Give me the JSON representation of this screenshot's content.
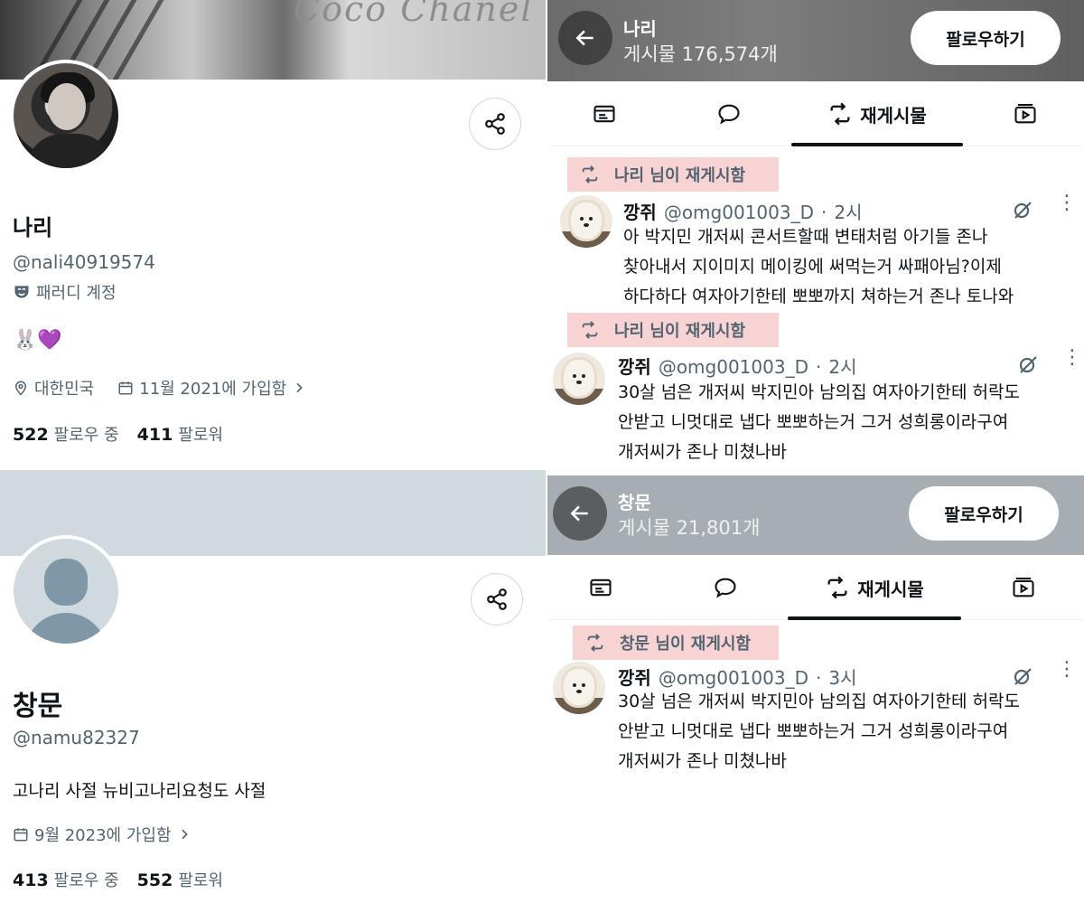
{
  "profile1": {
    "banner_text": "Coco Chanel",
    "display_name": "나리",
    "handle": "@nali40919574",
    "parody_label": "패러디 계정",
    "bio": "🐰💜",
    "location": "대한민국",
    "joined": "11월 2021에 가입함",
    "following_count": "522",
    "following_label": "팔로우 중",
    "followers_count": "411",
    "followers_label": "팔로워"
  },
  "profile2": {
    "display_name": "창문",
    "handle": "@namu82327",
    "bio": "고나리 사절 뉴비고나리요청도 사절",
    "joined": "9월 2023에 가입함",
    "following_count": "413",
    "following_label": "팔로우 중",
    "followers_count": "552",
    "followers_label": "팔로워"
  },
  "timeline1": {
    "header_name": "나리",
    "header_posts": "게시물 176,574개",
    "follow_label": "팔로우하기",
    "reposts_tab": "재게시물",
    "tweets": [
      {
        "repost_label": "나리 님이 재게시함",
        "author": "깡쥐",
        "handle": "@omg001003_D",
        "dot": "·",
        "time": "2시",
        "lines": [
          "아 박지민 개저씨 콘서트할때 변태처럼 아기들 존나",
          "찾아내서 지이미지 메이킹에 써먹는거 싸패아님?이제",
          "하다하다 여자아기한테 뽀뽀까지 쳐하는거 존나 토나와"
        ]
      },
      {
        "repost_label": "나리 님이 재게시함",
        "author": "깡쥐",
        "handle": "@omg001003_D",
        "dot": "·",
        "time": "2시",
        "lines": [
          "30살 넘은 개저씨 박지민아 남의집 여자아기한테 허락도",
          "안받고 니멋대로 냅다 뽀뽀하는거 그거 성희롱이라구여",
          "개저씨가 존나 미쳤나바"
        ]
      }
    ]
  },
  "timeline2": {
    "header_name": "창문",
    "header_posts": "게시물 21,801개",
    "follow_label": "팔로우하기",
    "reposts_tab": "재게시물",
    "tweets": [
      {
        "repost_label": "창문 님이 재게시함",
        "author": "깡쥐",
        "handle": "@omg001003_D",
        "dot": "·",
        "time": "3시",
        "lines": [
          "30살 넘은 개저씨 박지민아 남의집 여자아기한테 허락도",
          "안받고 니멋대로 냅다 뽀뽀하는거 그거 성희롱이라구여",
          "개저씨가 존나 미쳤나바"
        ]
      }
    ]
  },
  "icons": {
    "share": "share-icon",
    "location": "location-pin-icon",
    "calendar": "calendar-icon",
    "parody": "theater-mask-icon",
    "back": "arrow-left-icon",
    "repost": "repost-icon",
    "grok": "grok-icon"
  },
  "colors": {
    "text_primary": "#0f1419",
    "text_secondary": "#536471",
    "repost_highlight": "#f8d3d3",
    "default_avatar": "#7f97a6"
  }
}
